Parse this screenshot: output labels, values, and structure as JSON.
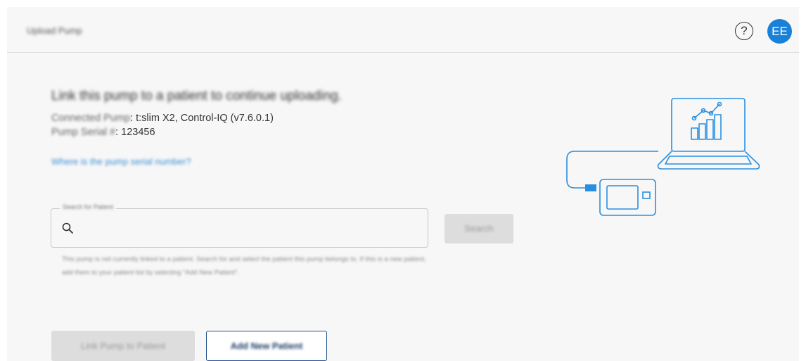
{
  "header": {
    "title": "Upload Pump",
    "help_icon": "?",
    "avatar_initials": "EE"
  },
  "main": {
    "heading": "Link this pump to a patient to continue uploading.",
    "connected_pump_label": "Connected Pump",
    "connected_pump_value": ": t:slim X2, Control-IQ (v7.6.0.1)",
    "serial_label": "Pump Serial #",
    "serial_value": ": 123456",
    "serial_link": "Where is the pump serial number?"
  },
  "search": {
    "legend": "Search for Patient",
    "value": "",
    "placeholder": "",
    "button_label": "Search",
    "helper": "This pump is not currently linked to a patient. Search for and select the patient this pump belongs to. If this is a new patient, add them to your patient list by selecting \"Add New Patient\"."
  },
  "actions": {
    "link_label": "Link Pump to Patient",
    "add_label": "Add New Patient"
  },
  "colors": {
    "accent": "#1a81d8",
    "illustration": "#2a8fe0",
    "primary_outline": "#1f4f8a"
  },
  "icons": [
    "help-icon",
    "search-icon",
    "laptop-chart-icon",
    "pump-icon"
  ]
}
